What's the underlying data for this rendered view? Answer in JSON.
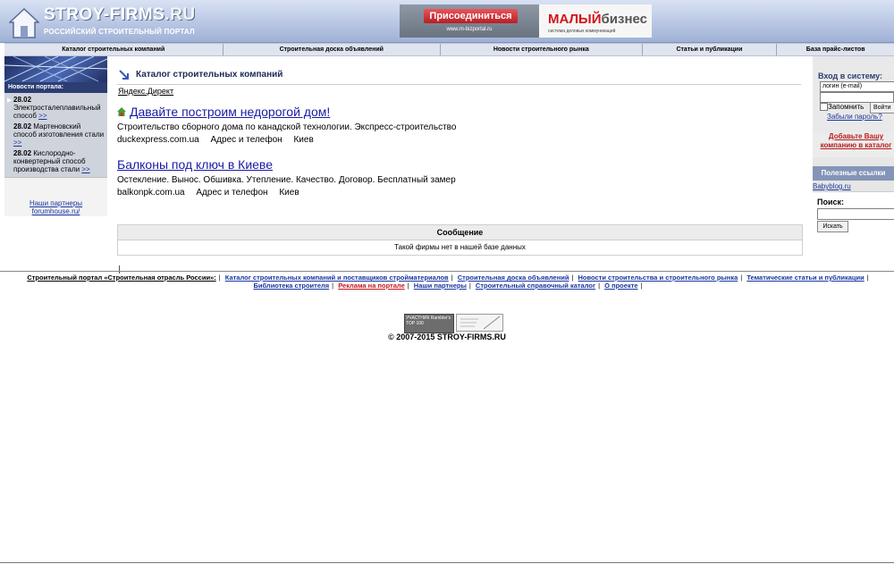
{
  "header": {
    "logo_title": "STROY-FIRMS",
    "logo_title_suffix": ".RU",
    "logo_subtitle": "РОССИЙСКИЙ СТРОИТЕЛЬНЫЙ ПОРТАЛ",
    "banner_button": "Присоединиться",
    "banner_url": "www.m-bizportal.ru",
    "banner_brand_red": "МАЛЫЙ",
    "banner_brand_grey": "бизнес",
    "banner_tagline": "система деловых коммуникаций"
  },
  "nav": {
    "items": [
      "Каталог строительных компаний",
      "Строительная доска объявлений",
      "Новости строительного рынка",
      "Статьи и публикации",
      "База прайс-листов"
    ]
  },
  "left": {
    "news_label": "Новости портала:",
    "news": [
      {
        "date": "28.02",
        "text": "Электросталеплавильный способ",
        "more": ">>"
      },
      {
        "date": "28.02",
        "text": "Мартеновский способ изготовления стали",
        "more": ">>"
      },
      {
        "date": "28.02",
        "text": "Кислородно-конвертерный способ производства стали",
        "more": ">>"
      }
    ],
    "partners_title": "Наши партнеры",
    "partners_link": "forumhouse.ru/"
  },
  "main": {
    "title": "Каталог строительных компаний",
    "yandex": "Яндекс.Директ",
    "ads": [
      {
        "title": "Давайте построим недорогой дом!",
        "desc": "Строительство сборного дома по канадской технологии. Экспресс-строительство",
        "domain": "duckexpress.com.ua",
        "contacts": "Адрес и телефон",
        "city": "Киев"
      },
      {
        "title": "Балконы под ключ в Киеве",
        "desc": "Остекление. Вынос. Обшивка. Утепление. Качество. Договор. Бесплатный замер",
        "domain": "balkonpk.com.ua",
        "contacts": "Адрес и телефон",
        "city": "Киев"
      }
    ],
    "message_head": "Сообщение",
    "message_body": "Такой фирмы нет в нашей базе данных"
  },
  "right": {
    "login_title": "Вход в систему:",
    "login_placeholder": "логин (e-mail)",
    "remember": "Запомнить",
    "enter": "Войти",
    "forgot": "Забыли пароль?",
    "add_company": "Добавьте Вашу компанию в каталог",
    "useful_head": "Полезные ссылки",
    "useful_link": "Babyblog.ru",
    "search_label": "Поиск:",
    "search_button": "Искать"
  },
  "footer": {
    "links": [
      "Строительный портал «Строительная отрасль России»:",
      "Каталог строительных компаний и поставщиков стройматериалов",
      "Строительная доска объявлений",
      "Новости строительства и строительного рынка",
      "Тематические статьи и публикации",
      "Библиотека строителя",
      "Реклама на портале",
      "Наши партнеры",
      "Строительный справочный каталог",
      "О проекте"
    ],
    "counter_rambler": "УЧАСТНИК Rambler's TOP 100",
    "copyright": "© 2007-2015 STROY-FIRMS.RU"
  },
  "colors": {
    "header_gradient_top": "#d9e2f4",
    "header_gradient_bottom": "#9fb1d6",
    "link_blue": "#1a1aa6",
    "accent_red": "#c8151b",
    "sidebar_grey": "#cfd3dc"
  }
}
